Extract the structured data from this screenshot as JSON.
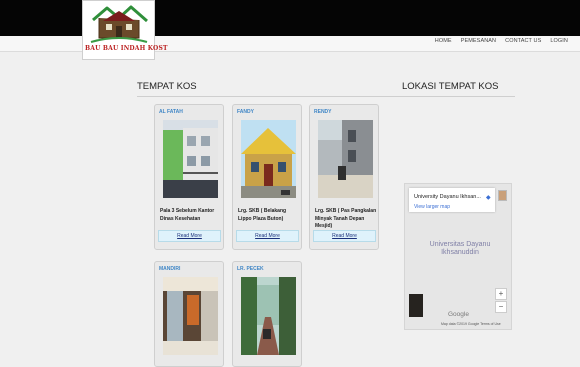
{
  "logo": {
    "text": "BAU BAU INDAH KOST"
  },
  "nav": {
    "home": "HOME",
    "pemesanan": "PEMESANAN",
    "contact": "CONTACT US",
    "login": "LOGIN"
  },
  "sections": {
    "kos": "TEMPAT KOS",
    "lokasi": "LOKASI TEMPAT KOS"
  },
  "cards": [
    {
      "title": "AL FATAH",
      "desc": "Pala 3 Sebelum Kantor Dinas Kesehatan",
      "button": "Read More"
    },
    {
      "title": "FANDY",
      "desc": "Lrg. SKB ( Belakang Lippo Plaza Buton)",
      "button": "Read More"
    },
    {
      "title": "RENDY",
      "desc": "Lrg. SKB ( Pas Pangkalan Minyak Tanah Depan Mesjid)",
      "button": "Read More"
    },
    {
      "title": "MANDIRI"
    },
    {
      "title": "LR. PECEK"
    }
  ],
  "map": {
    "place_name": "University Dayanu Ikhsan...",
    "view_larger": "View larger map",
    "label": "Universitas Dayanu Ikhsanuddin",
    "zoom_in": "+",
    "zoom_out": "−",
    "google": "Google",
    "footer": "Map data ©2019 Google    Terms of Use"
  }
}
